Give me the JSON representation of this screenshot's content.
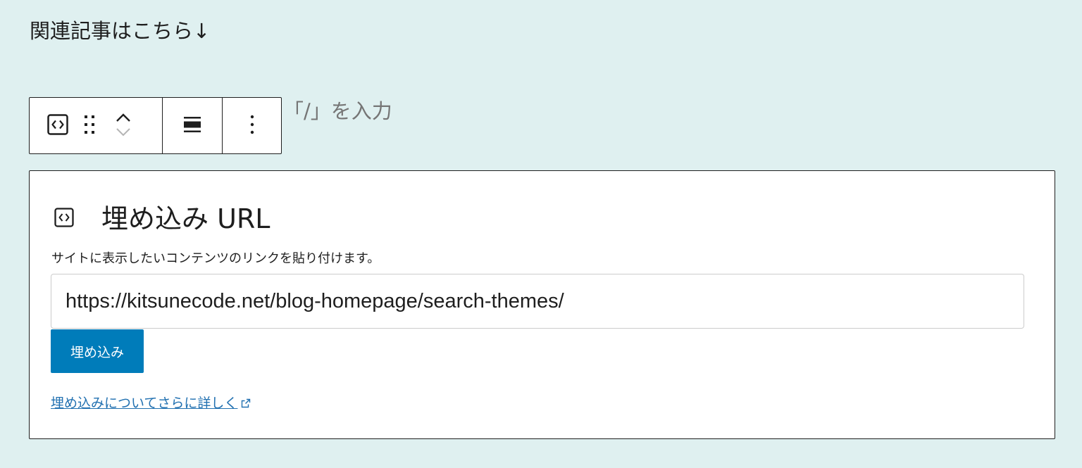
{
  "paragraph": {
    "text": "関連記事はこちら↓"
  },
  "toolbar": {
    "block_type_icon": "embed-icon",
    "drag_icon": "drag-handle-icon",
    "move_up_icon": "chevron-up-icon",
    "move_down_icon": "chevron-down-icon",
    "align_icon": "align-wide-icon",
    "options_icon": "more-vertical-icon"
  },
  "placeholder": {
    "text": "「/」を入力"
  },
  "embed": {
    "icon": "embed-icon",
    "title": "埋め込み URL",
    "description": "サイトに表示したいコンテンツのリンクを貼り付けます。",
    "url_value": "https://kitsunecode.net/blog-homepage/search-themes/",
    "button_label": "埋め込み",
    "learn_more_label": "埋め込みについてさらに詳しく",
    "learn_more_icon": "external-link-icon",
    "button_color": "#007cba",
    "link_color": "#2271b1"
  },
  "colors": {
    "background": "#dff0f0",
    "text": "#1e1e1e",
    "placeholder": "#757575"
  }
}
